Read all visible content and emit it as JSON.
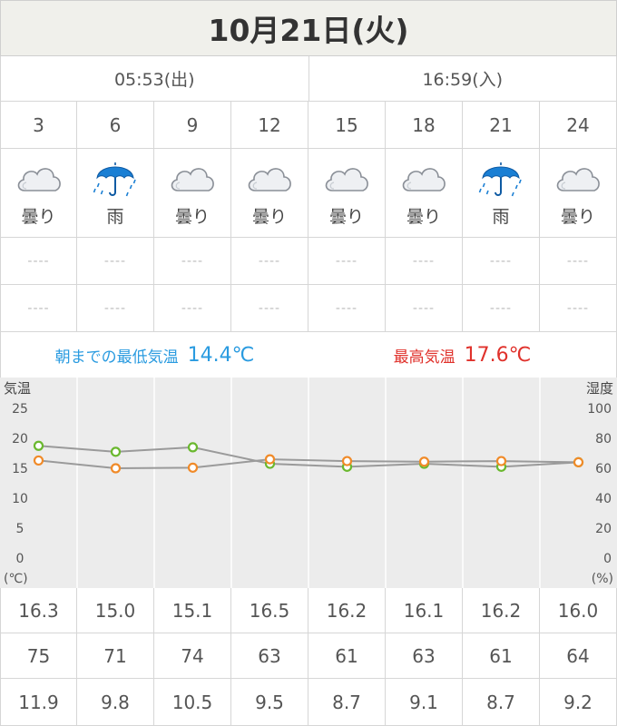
{
  "title": "10月21日(火)",
  "sunrise": "05:53(出)",
  "sunset": "16:59(入)",
  "hours": [
    "3",
    "6",
    "9",
    "12",
    "15",
    "18",
    "21",
    "24"
  ],
  "weather": [
    {
      "icon": "cloud-icon",
      "label": "曇り"
    },
    {
      "icon": "umbrella-rain-icon",
      "label": "雨"
    },
    {
      "icon": "cloud-icon",
      "label": "曇り"
    },
    {
      "icon": "cloud-icon",
      "label": "曇り"
    },
    {
      "icon": "cloud-icon",
      "label": "曇り"
    },
    {
      "icon": "cloud-icon",
      "label": "曇り"
    },
    {
      "icon": "umbrella-rain-icon",
      "label": "雨"
    },
    {
      "icon": "cloud-icon",
      "label": "曇り"
    }
  ],
  "dash_row_1": [
    "----",
    "----",
    "----",
    "----",
    "----",
    "----",
    "----",
    "----"
  ],
  "dash_row_2": [
    "----",
    "----",
    "----",
    "----",
    "----",
    "----",
    "----",
    "----"
  ],
  "min_temp": {
    "label": "朝までの最低気温",
    "value": "14.4℃"
  },
  "max_temp": {
    "label": "最高気温",
    "value": "17.6℃"
  },
  "colors": {
    "min": "#2a9be0",
    "max": "#e0322c",
    "temp_series": "#f08a28",
    "humidity_series": "#6ab82e"
  },
  "chart_data": {
    "type": "line",
    "left_axis_title": "気温",
    "right_axis_title": "湿度",
    "left_unit": "(℃)",
    "right_unit": "(%)",
    "left_ticks": [
      "25",
      "20",
      "15",
      "10",
      "5",
      "0"
    ],
    "right_ticks": [
      "100",
      "80",
      "60",
      "40",
      "20",
      "0"
    ],
    "ylim_left": [
      0,
      25
    ],
    "ylim_right": [
      0,
      100
    ],
    "categories": [
      "3",
      "6",
      "9",
      "12",
      "15",
      "18",
      "21",
      "24"
    ],
    "series": [
      {
        "values_temperature": [
          16.3,
          15.0,
          15.1,
          16.5,
          16.2,
          16.1,
          16.2,
          16.0
        ]
      },
      {
        "values_humidity": [
          75,
          71,
          74,
          63,
          61,
          63,
          61,
          64
        ]
      }
    ],
    "grid": true
  },
  "row_temperature": [
    "16.3",
    "15.0",
    "15.1",
    "16.5",
    "16.2",
    "16.1",
    "16.2",
    "16.0"
  ],
  "row_humidity": [
    "75",
    "71",
    "74",
    "63",
    "61",
    "63",
    "61",
    "64"
  ],
  "row_third": [
    "11.9",
    "9.8",
    "10.5",
    "9.5",
    "8.7",
    "9.1",
    "8.7",
    "9.2"
  ]
}
